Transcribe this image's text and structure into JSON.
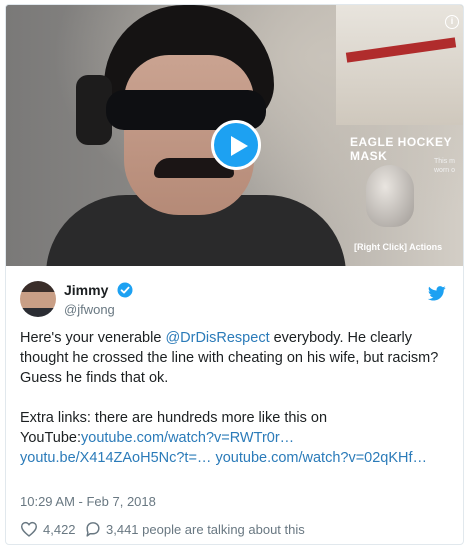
{
  "video": {
    "overlay_title": "EAGLE HOCKEY MASK",
    "overlay_sub": "This m worn o",
    "overlay_actions": "[Right Click] Actions"
  },
  "author": {
    "name": "Jimmy",
    "handle": "@jfwong"
  },
  "tweet": {
    "text_before": "Here's your venerable ",
    "mention": "@DrDisRespect",
    "text_after": " everybody. He clearly thought he crossed the line with cheating on his wife, but racism? Guess he finds that ok.",
    "extra_prefix": "Extra links: there are hundreds more like this on YouTube:",
    "links": [
      "youtube.com/watch?v=RWTr0r…",
      "youtu.be/X414ZAoH5Nc?t=…",
      "youtube.com/watch?v=02qKHf…"
    ],
    "timestamp": "10:29 AM - Feb 7, 2018"
  },
  "stats": {
    "likes": "4,422",
    "talking": "3,441 people are talking about this"
  },
  "colors": {
    "accent": "#1da1f2",
    "link": "#2b7bb9",
    "muted": "#697882"
  },
  "icons": [
    "info-icon",
    "play-icon",
    "verified-badge-icon",
    "twitter-bird-icon",
    "heart-icon",
    "reply-bubble-icon"
  ]
}
